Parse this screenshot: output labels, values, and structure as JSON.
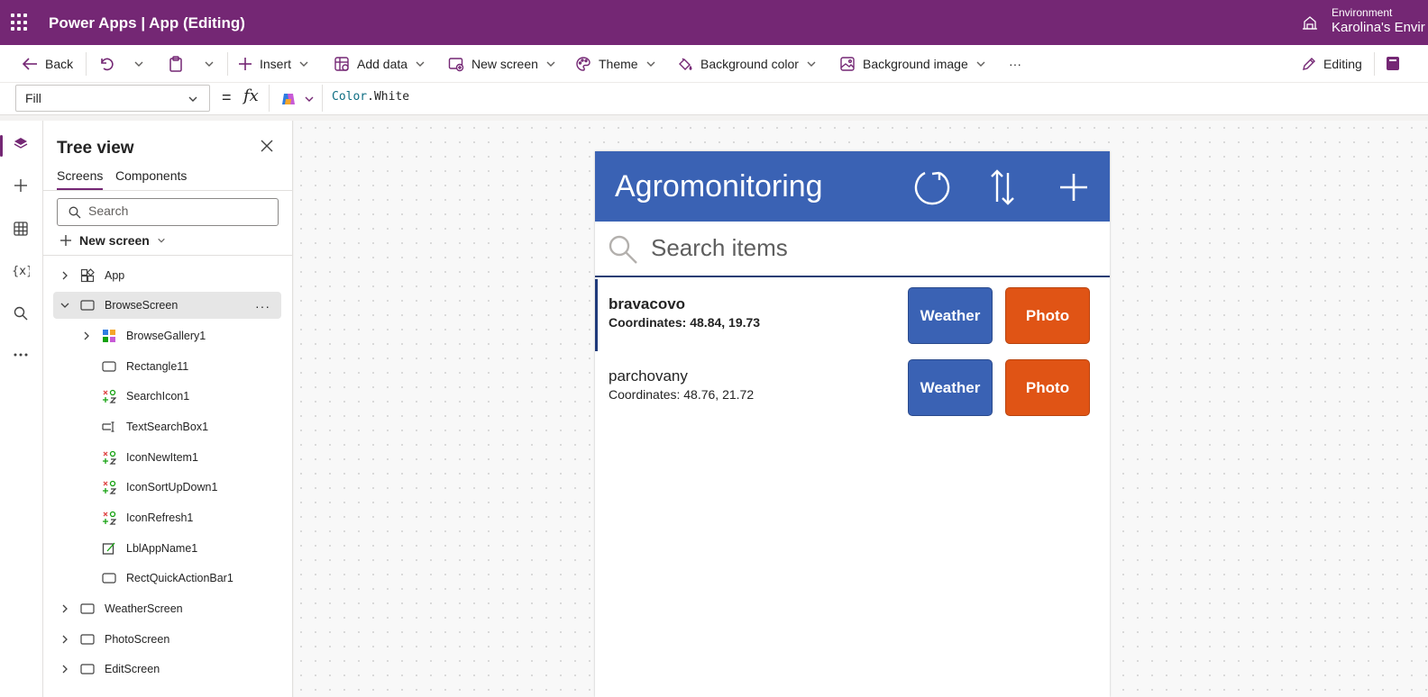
{
  "topbar": {
    "brand": "Power Apps  |  App (Editing)",
    "environment_label": "Environment",
    "environment_value": "Karolina's Envir"
  },
  "commandbar": {
    "back": "Back",
    "insert": "Insert",
    "add_data": "Add data",
    "new_screen": "New screen",
    "theme": "Theme",
    "background_color": "Background color",
    "background_image": "Background image",
    "more": "···",
    "editing": "Editing"
  },
  "formulabar": {
    "property": "Fill",
    "equals": "=",
    "fx": "fx",
    "formula_object": "Color",
    "formula_dot": ".",
    "formula_member": "White"
  },
  "treeview": {
    "title": "Tree view",
    "tabs": [
      "Screens",
      "Components"
    ],
    "search_placeholder": "Search",
    "new_screen": "New screen",
    "nodes": [
      {
        "label": "App"
      },
      {
        "label": "BrowseScreen"
      },
      {
        "label": "BrowseGallery1"
      },
      {
        "label": "Rectangle11"
      },
      {
        "label": "SearchIcon1"
      },
      {
        "label": "TextSearchBox1"
      },
      {
        "label": "IconNewItem1"
      },
      {
        "label": "IconSortUpDown1"
      },
      {
        "label": "IconRefresh1"
      },
      {
        "label": "LblAppName1"
      },
      {
        "label": "RectQuickActionBar1"
      },
      {
        "label": "WeatherScreen"
      },
      {
        "label": "PhotoScreen"
      },
      {
        "label": "EditScreen"
      }
    ]
  },
  "app": {
    "title": "Agromonitoring",
    "search_placeholder": "Search items",
    "items": [
      {
        "name": "bravacovo",
        "coords": "Coordinates: 48.84, 19.73",
        "weather": "Weather",
        "photo": "Photo"
      },
      {
        "name": "parchovany",
        "coords": "Coordinates: 48.76, 21.72",
        "weather": "Weather",
        "photo": "Photo"
      }
    ]
  },
  "colors": {
    "brand_purple": "#742774",
    "app_header_blue": "#3a62b4",
    "photo_orange": "#e05415"
  }
}
